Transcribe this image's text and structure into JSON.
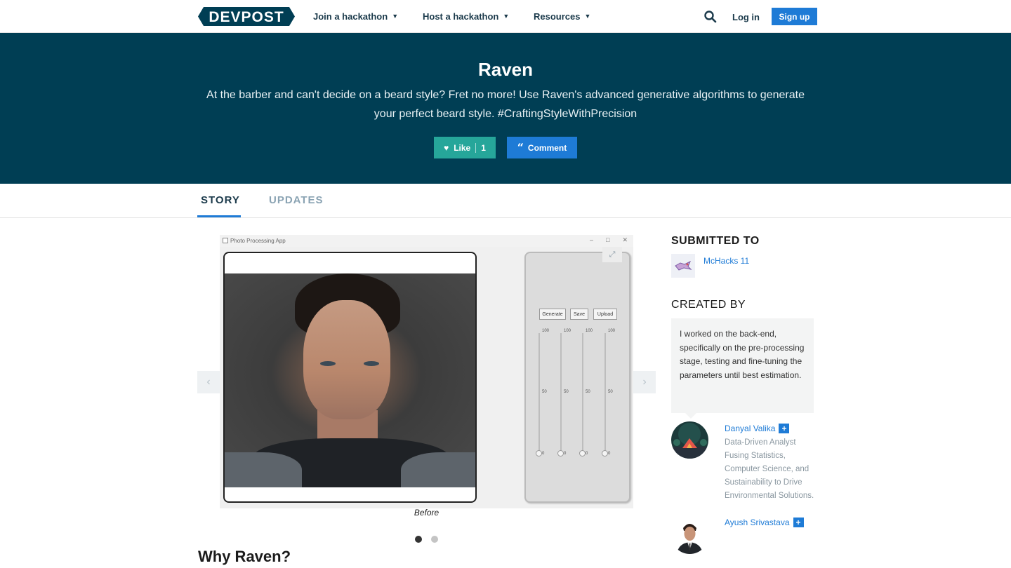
{
  "nav": {
    "logo_text": "DEVPOST",
    "join": "Join a hackathon",
    "host": "Host a hackathon",
    "resources": "Resources",
    "login": "Log in",
    "signup": "Sign up",
    "icons": {
      "search": "search-icon",
      "chevron": "chevron-down-icon"
    }
  },
  "hero": {
    "title": "Raven",
    "tagline": "At the barber and can't decide on a beard style? Fret no more! Use Raven's advanced generative algorithms to generate your perfect beard style. #CraftingStyleWithPrecision",
    "like_label": "Like",
    "like_count": "1",
    "comment_label": "Comment"
  },
  "tabs": [
    {
      "label": "STORY",
      "active": true
    },
    {
      "label": "UPDATES",
      "active": false
    }
  ],
  "gallery": {
    "window_title": "Photo Processing App",
    "buttons": [
      "Generate",
      "Save",
      "Upload"
    ],
    "slider_labels": {
      "top": "100",
      "mid": "50",
      "bottom": "0"
    },
    "slider_values": [
      0,
      0,
      0,
      0
    ],
    "caption": "Before",
    "slide_count": 2,
    "active_slide": 1
  },
  "story": {
    "section_heading": "Why Raven?"
  },
  "sidebar": {
    "submitted_to_heading": "SUBMITTED TO",
    "hackathon_name": "McHacks 11",
    "created_by_heading": "CREATED BY",
    "contribution": "I worked on the back-end, specifically on the pre-processing stage, testing and fine-tuning the parameters until best estimation.",
    "members": [
      {
        "name": "Danyal Valika",
        "bio": "Data-Driven Analyst Fusing Statistics, Computer Science, and Sustainability to Drive Environmental Solutions."
      },
      {
        "name": "Ayush Srivastava"
      }
    ]
  },
  "colors": {
    "hero_bg": "#003e54",
    "accent_blue": "#1e7bd6",
    "like_teal": "#26a69a",
    "logo_dark": "#003e54"
  }
}
